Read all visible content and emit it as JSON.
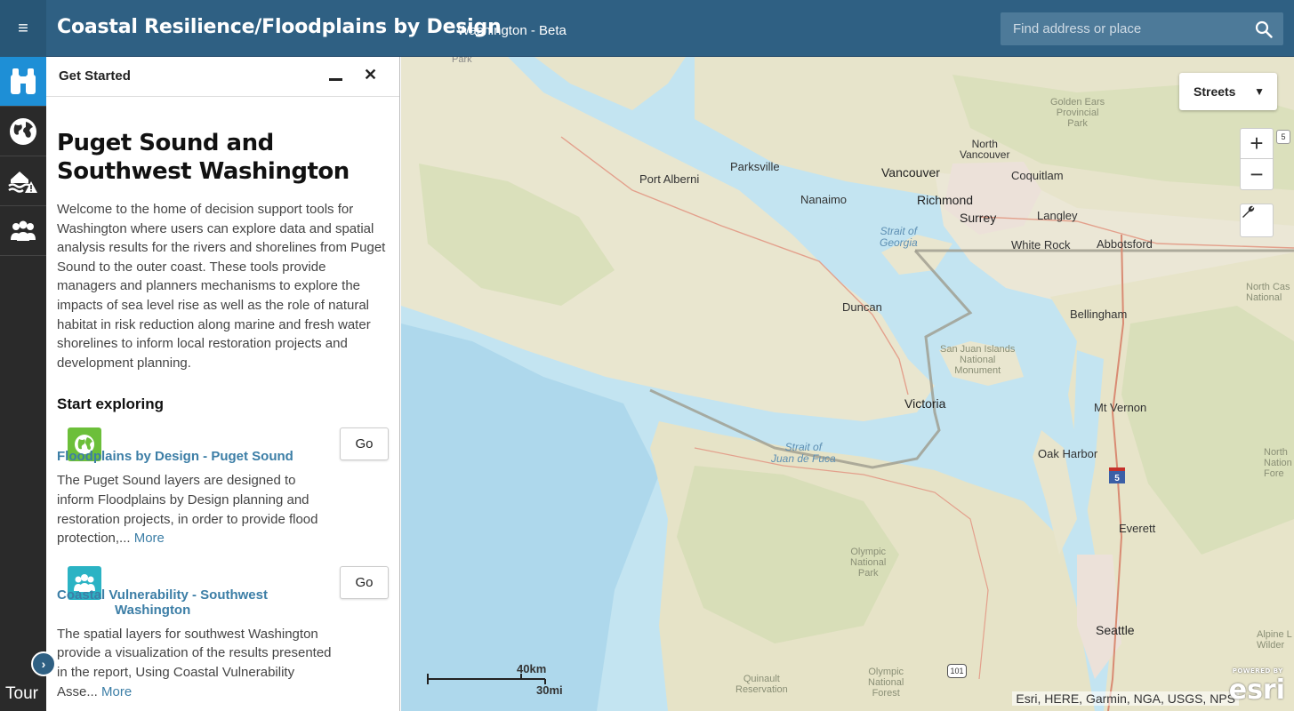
{
  "header": {
    "title": "Coastal Resilience/Floodplains by Design",
    "subtitle": "Washington - Beta",
    "search_placeholder": "Find address or place"
  },
  "sidebar": {
    "items": [
      {
        "icon": "binoculars-icon",
        "active": true
      },
      {
        "icon": "globe-icon",
        "active": false
      },
      {
        "icon": "flood-warning-icon",
        "active": false
      },
      {
        "icon": "people-icon",
        "active": false
      }
    ],
    "tour_label": "Tour"
  },
  "panel": {
    "title": "Get Started",
    "heading": "Puget Sound and Southwest Washington",
    "intro": "Welcome to the home of decision support tools for Washington where users can explore data and spatial analysis results for the rivers and shorelines from Puget Sound to the outer coast. These tools provide managers and planners mechanisms to explore the impacts of sea level rise as well as the role of natural habitat in risk reduction along marine and fresh water shorelines to inform local restoration projects and development planning.",
    "start_label": "Start exploring",
    "tools": [
      {
        "title": "Floodplains by Design - Puget Sound",
        "desc": "The Puget Sound layers are designed to inform Floodplains by Design planning and restoration projects, in order to provide flood protection,...",
        "more": "More",
        "go": "Go",
        "icon_color": "#6cbf3a"
      },
      {
        "title": "Coastal Vulnerability - Southwest Washington",
        "desc": "The spatial layers for southwest Washington provide a visualization of the results presented in the report, Using Coastal Vulnerability Asse...",
        "more": "More",
        "go": "Go",
        "icon_color": "#2bb3c4"
      }
    ]
  },
  "map": {
    "basemap": "Streets",
    "zoom_in": "+",
    "zoom_out": "−",
    "scale_km": "40km",
    "scale_mi": "30mi",
    "attribution": "Esri, HERE, Garmin, NGA, USGS, NPS",
    "esri_logo": "esri",
    "esri_powered": "POWERED BY",
    "labels": {
      "vancouver": "Vancouver",
      "north_vancouver": "North\nVancouver",
      "coquitlam": "Coquitlam",
      "richmond": "Richmond",
      "surrey": "Surrey",
      "langley": "Langley",
      "white_rock": "White Rock",
      "abbotsford": "Abbotsford",
      "port_alberni": "Port Alberni",
      "parksville": "Parksville",
      "nanaimo": "Nanaimo",
      "duncan": "Duncan",
      "victoria": "Victoria",
      "bellingham": "Bellingham",
      "mt_vernon": "Mt Vernon",
      "oak_harbor": "Oak Harbor",
      "everett": "Everett",
      "seattle": "Seattle",
      "strait_georgia": "Strait of\nGeorgia",
      "strait_juan": "Strait of\nJuan de Fuca",
      "san_juan": "San Juan Islands\nNational\nMonument",
      "olympic_np": "Olympic\nNational\nPark",
      "olympic_nf": "Olympic\nNational\nForest",
      "quinault": "Quinault\nReservation",
      "golden_ears": "Golden Ears\nProvincial\nPark",
      "north_cascades": "North Cas\nNational",
      "ne_corner": "North\nNation\nFore",
      "alpine": "Alpine L\nWilder",
      "park_top": "Park",
      "hwy_5": "5",
      "hwy_101": "101"
    }
  }
}
